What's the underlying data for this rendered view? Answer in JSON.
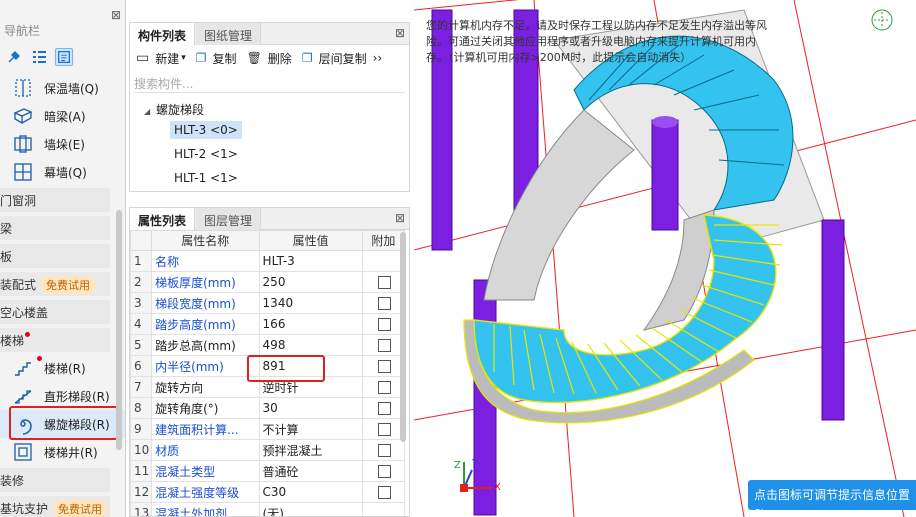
{
  "nav": {
    "title": "导航栏",
    "close": "⊠",
    "items_top": [
      {
        "label": "保温墙(Q)"
      },
      {
        "label": "暗梁(A)"
      },
      {
        "label": "墙垛(E)"
      },
      {
        "label": "幕墙(Q)"
      }
    ],
    "categories": {
      "door": "门窗洞",
      "beam": "梁",
      "slab": "板",
      "prefab": "装配式",
      "prefab_badge": "免费试用",
      "hollow": "空心楼盖",
      "stairs": "楼梯",
      "decoration": "装修",
      "pit": "基坑支护",
      "pit_badge": "免费试用"
    },
    "stair_items": [
      {
        "label": "楼梯(R)"
      },
      {
        "label": "直形梯段(R)"
      },
      {
        "label": "螺旋梯段(R)"
      },
      {
        "label": "楼梯井(R)"
      }
    ]
  },
  "components": {
    "tab_active": "构件列表",
    "tab_other": "图纸管理",
    "close": "⊠",
    "toolbar": {
      "new": "新建",
      "copy": "复制",
      "delete": "删除",
      "floor_copy": "层间复制",
      "more": "››"
    },
    "search_placeholder": "搜索构件...",
    "group": "螺旋梯段",
    "items": [
      "HLT-3 <0>",
      "HLT-2 <1>",
      "HLT-1 <1>"
    ]
  },
  "properties": {
    "tab_active": "属性列表",
    "tab_other": "图层管理",
    "close": "⊠",
    "headers": {
      "name": "属性名称",
      "value": "属性值",
      "extra": "附加"
    },
    "rows": [
      {
        "n": "1",
        "name": "名称",
        "value": "HLT-3",
        "blue": true,
        "check": false
      },
      {
        "n": "2",
        "name": "梯板厚度(mm)",
        "value": "250",
        "blue": true,
        "check": true
      },
      {
        "n": "3",
        "name": "梯段宽度(mm)",
        "value": "1340",
        "blue": true,
        "check": true
      },
      {
        "n": "4",
        "name": "踏步高度(mm)",
        "value": "166",
        "blue": true,
        "check": true
      },
      {
        "n": "5",
        "name": "踏步总高(mm)",
        "value": "498",
        "blue": false,
        "check": true
      },
      {
        "n": "6",
        "name": "内半径(mm)",
        "value": "891",
        "blue": true,
        "check": true
      },
      {
        "n": "7",
        "name": "旋转方向",
        "value": "逆时针",
        "blue": false,
        "check": true
      },
      {
        "n": "8",
        "name": "旋转角度(°)",
        "value": "30",
        "blue": false,
        "check": true
      },
      {
        "n": "9",
        "name": "建筑面积计算...",
        "value": "不计算",
        "blue": true,
        "check": true
      },
      {
        "n": "10",
        "name": "材质",
        "value": "预拌混凝土",
        "blue": true,
        "check": true
      },
      {
        "n": "11",
        "name": "混凝土类型",
        "value": "普通砼",
        "blue": true,
        "check": true
      },
      {
        "n": "12",
        "name": "混凝土强度等级",
        "value": "C30",
        "blue": true,
        "check": true
      },
      {
        "n": "13",
        "name": "混凝土外加剂",
        "value": "(无)",
        "blue": true,
        "check": false
      }
    ]
  },
  "view": {
    "message": "您的计算机内存不足，请及时保存工程以防内存不足发生内存溢出等风险。可通过关闭其他应用程序或者升级电脑内存来提升计算机可用内存。（计算机可用内存>200M时，此提示会自动消失）",
    "tip": "点击图标可调节提示信息位置~",
    "axis_x": "X",
    "axis_y": "Y",
    "axis_z": "Z"
  }
}
